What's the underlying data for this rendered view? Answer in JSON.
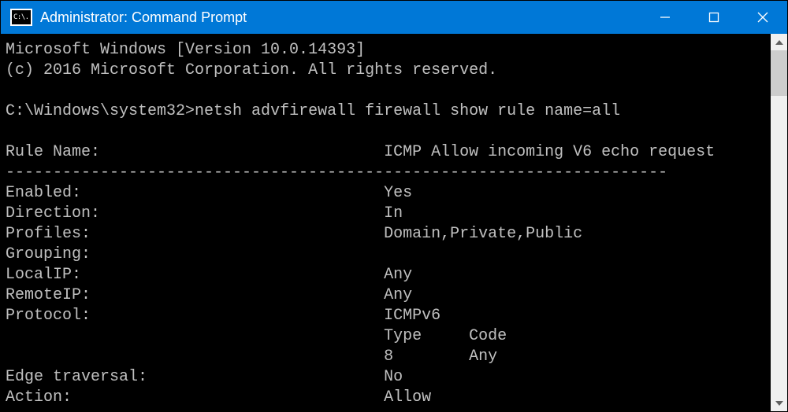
{
  "titlebar": {
    "icon_label": "C:\\.",
    "title": "Administrator: Command Prompt"
  },
  "terminal": {
    "header_line1": "Microsoft Windows [Version 10.0.14393]",
    "header_line2": "(c) 2016 Microsoft Corporation. All rights reserved.",
    "prompt": "C:\\Windows\\system32>",
    "command": "netsh advfirewall firewall show rule name=all",
    "rule": {
      "label_rulename": "Rule Name:",
      "value_rulename": "ICMP Allow incoming V6 echo request",
      "separator": "----------------------------------------------------------------------",
      "label_enabled": "Enabled:",
      "value_enabled": "Yes",
      "label_direction": "Direction:",
      "value_direction": "In",
      "label_profiles": "Profiles:",
      "value_profiles": "Domain,Private,Public",
      "label_grouping": "Grouping:",
      "value_grouping": "",
      "label_localip": "LocalIP:",
      "value_localip": "Any",
      "label_remoteip": "RemoteIP:",
      "value_remoteip": "Any",
      "label_protocol": "Protocol:",
      "value_protocol": "ICMPv6",
      "header_type": "Type",
      "header_code": "Code",
      "value_type": "8",
      "value_code": "Any",
      "label_edge": "Edge traversal:",
      "value_edge": "No",
      "label_action": "Action:",
      "value_action": "Allow"
    }
  }
}
